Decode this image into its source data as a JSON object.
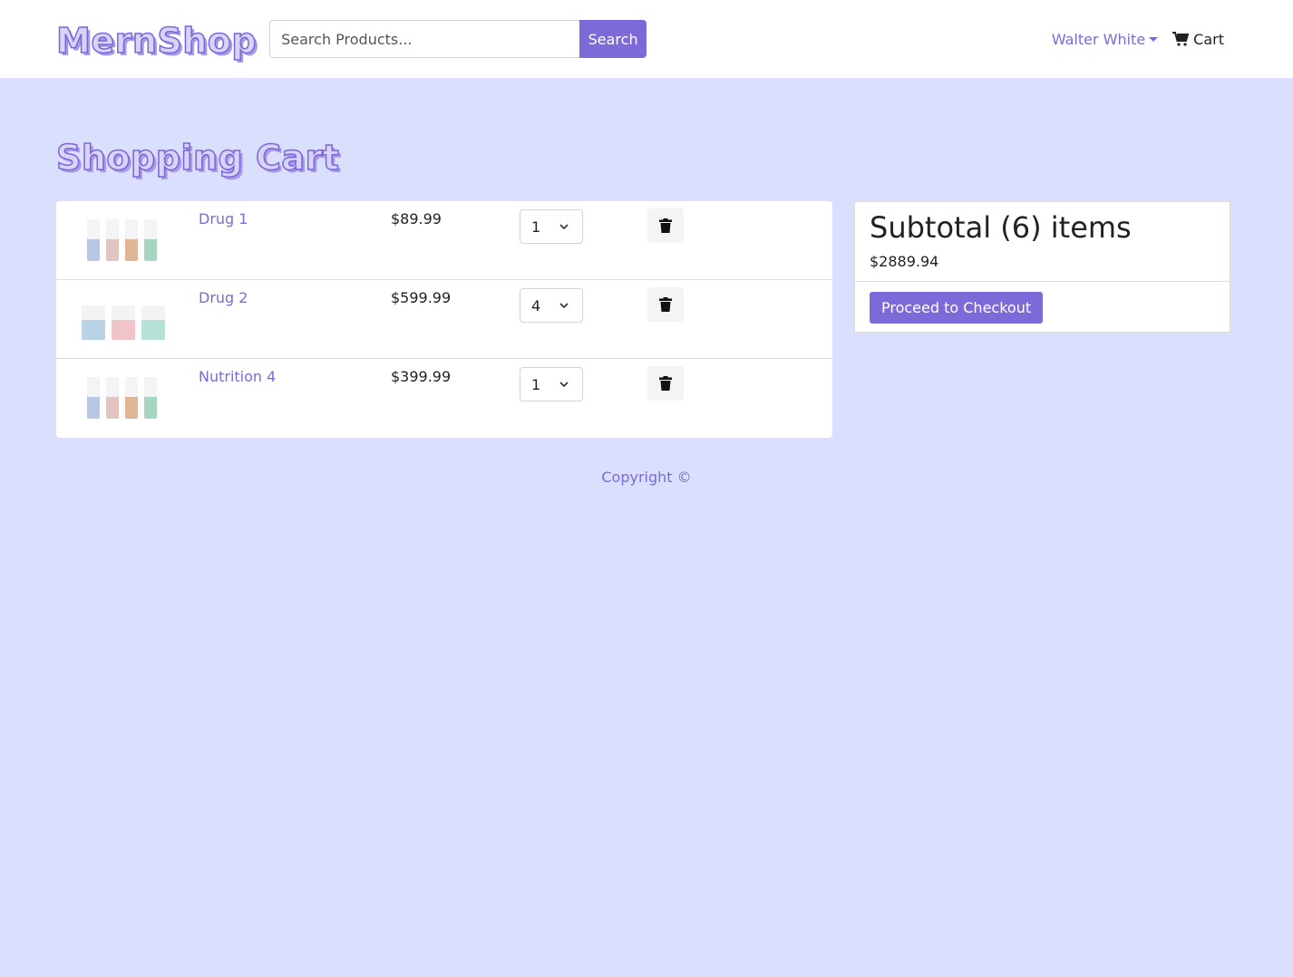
{
  "navbar": {
    "brand": "MernShop",
    "search_placeholder": "Search Products...",
    "search_button": "Search",
    "user_name": "Walter White",
    "cart_label": "Cart"
  },
  "page": {
    "title": "Shopping Cart"
  },
  "cart": {
    "items": [
      {
        "name": "Drug 1",
        "price": "$89.99",
        "qty": "1"
      },
      {
        "name": "Drug 2",
        "price": "$599.99",
        "qty": "4"
      },
      {
        "name": "Nutrition 4",
        "price": "$399.99",
        "qty": "1"
      }
    ]
  },
  "summary": {
    "subtotal_label": "Subtotal (6) items",
    "subtotal_amount": "$2889.94",
    "checkout_button": "Proceed to Checkout"
  },
  "footer": {
    "copyright": "Copyright ©"
  },
  "colors": {
    "accent": "#7d6ad8",
    "background": "#dadffe"
  }
}
